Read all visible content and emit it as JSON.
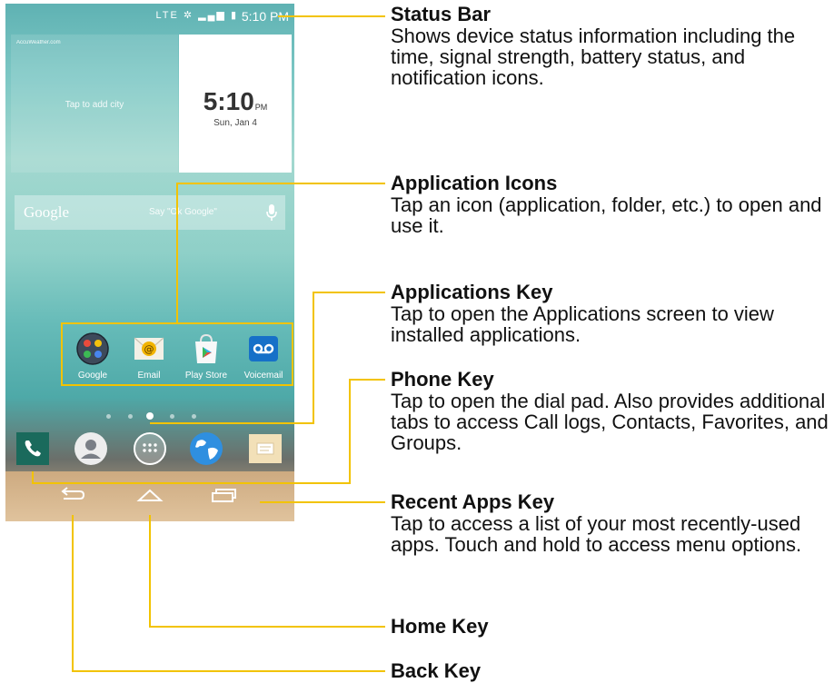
{
  "phone": {
    "status_bar": {
      "network": "LTE",
      "time": "5:10 PM"
    },
    "weather_widget": {
      "brand": "AccuWeather.com",
      "cta": "Tap to add city"
    },
    "clock_widget": {
      "time": "5:10",
      "ampm": "PM",
      "date": "Sun, Jan 4"
    },
    "search_bar": {
      "logo": "Google",
      "hint": "Say \"Ok Google\""
    },
    "apps": [
      {
        "label": "Google",
        "icon": "google-folder-icon"
      },
      {
        "label": "Email",
        "icon": "email-icon"
      },
      {
        "label": "Play Store",
        "icon": "play-store-icon"
      },
      {
        "label": "Voicemail",
        "icon": "voicemail-icon"
      }
    ],
    "page_indicator": {
      "pages": 5,
      "current": 3
    },
    "dock": [
      "phone-icon",
      "contacts-icon",
      "apps-grid-icon",
      "browser-globe-icon",
      "messaging-icon"
    ],
    "nav_keys": [
      "back-icon",
      "home-icon",
      "recent-apps-icon"
    ]
  },
  "callouts": [
    {
      "title": "Status Bar",
      "desc": "Shows device status information including the time, signal strength, battery status, and notification icons."
    },
    {
      "title": "Application Icons",
      "desc": "Tap an icon (application, folder, etc.) to open and use it."
    },
    {
      "title": "Applications Key",
      "desc": "Tap to open the Applications screen to view installed applications."
    },
    {
      "title": "Phone Key",
      "desc": "Tap to open the dial pad. Also provides additional tabs to access Call logs, Contacts, Favorites, and Groups."
    },
    {
      "title": "Recent Apps Key",
      "desc": "Tap to access a list of your most recently-used apps. Touch and hold to access menu options."
    },
    {
      "title": "Home Key",
      "desc": ""
    },
    {
      "title": "Back Key",
      "desc": ""
    }
  ],
  "colors": {
    "leader_line": "#f2c300"
  }
}
